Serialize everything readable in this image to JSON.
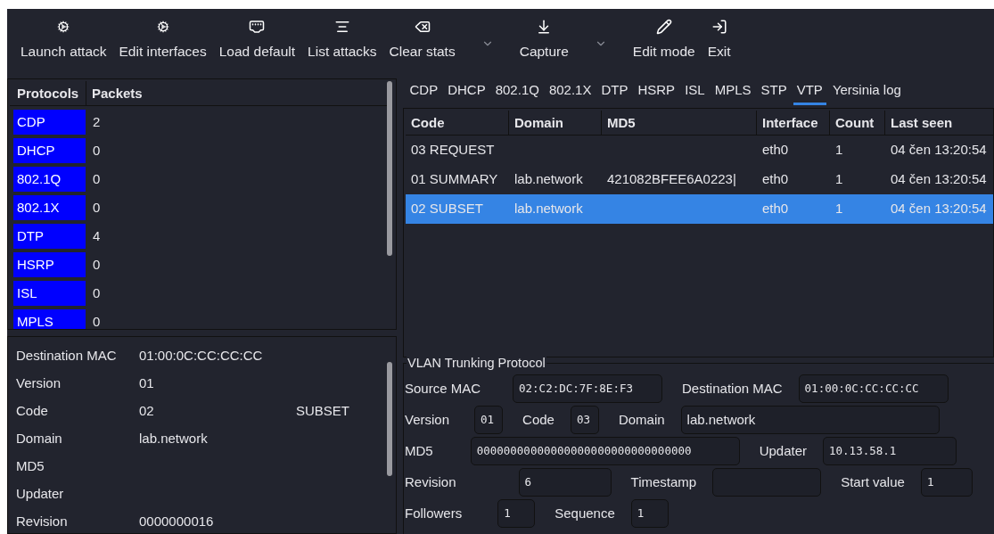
{
  "toolbar": [
    {
      "label": "Launch attack",
      "has_menu": false
    },
    {
      "label": "Edit interfaces",
      "has_menu": false
    },
    {
      "label": "Load default",
      "has_menu": false
    },
    {
      "label": "List attacks",
      "has_menu": false
    },
    {
      "label": "Clear stats",
      "has_menu": true
    },
    {
      "label": "Capture",
      "has_menu": true
    },
    {
      "label": "Edit mode",
      "has_menu": false
    },
    {
      "label": "Exit",
      "has_menu": false
    }
  ],
  "protocols_table": {
    "columns": [
      "Protocols",
      "Packets"
    ],
    "rows": [
      {
        "protocol": "CDP",
        "packets": "2"
      },
      {
        "protocol": "DHCP",
        "packets": "0"
      },
      {
        "protocol": "802.1Q",
        "packets": "0"
      },
      {
        "protocol": "802.1X",
        "packets": "0"
      },
      {
        "protocol": "DTP",
        "packets": "4"
      },
      {
        "protocol": "HSRP",
        "packets": "0"
      },
      {
        "protocol": "ISL",
        "packets": "0"
      },
      {
        "protocol": "MPLS",
        "packets": "0"
      }
    ]
  },
  "details": [
    {
      "label": "Destination MAC",
      "value": "01:00:0C:CC:CC:CC"
    },
    {
      "label": "Version",
      "value": "01"
    },
    {
      "label": "Code",
      "value": "02",
      "extra": "SUBSET"
    },
    {
      "label": "Domain",
      "value": "lab.network"
    },
    {
      "label": "MD5"
    },
    {
      "label": "Updater"
    },
    {
      "label": "Revision",
      "value": "0000000016"
    }
  ],
  "tabs": [
    {
      "label": "CDP",
      "selected": false
    },
    {
      "label": "DHCP",
      "selected": false
    },
    {
      "label": "802.1Q",
      "selected": false
    },
    {
      "label": "802.1X",
      "selected": false
    },
    {
      "label": "DTP",
      "selected": false
    },
    {
      "label": "HSRP",
      "selected": false
    },
    {
      "label": "ISL",
      "selected": false
    },
    {
      "label": "MPLS",
      "selected": false
    },
    {
      "label": "STP",
      "selected": false
    },
    {
      "label": "VTP",
      "selected": true
    },
    {
      "label": "Yersinia log",
      "selected": false
    }
  ],
  "packets_table": {
    "columns": [
      "Code",
      "Domain",
      "MD5",
      "Interface",
      "Count",
      "Last seen"
    ],
    "rows": [
      {
        "cells": [
          "03 REQUEST",
          "",
          "",
          "eth0",
          "1",
          "04 čen 13:20:54"
        ],
        "selected": false
      },
      {
        "cells": [
          "01 SUMMARY",
          "lab.network",
          "421082BFEE6A0223|",
          "eth0",
          "1",
          "04 čen 13:20:54"
        ],
        "selected": false
      },
      {
        "cells": [
          "02 SUBSET",
          "lab.network",
          "",
          "eth0",
          "1",
          "04 čen 13:20:54"
        ],
        "selected": true
      }
    ]
  },
  "vtp_form": {
    "title": "VLAN Trunking Protocol",
    "rows": [
      [
        {
          "label": "Source MAC",
          "value": "02:C2:DC:7F:8E:F3"
        },
        {
          "label": "Destination MAC",
          "value": "01:00:0C:CC:CC:CC"
        }
      ],
      [
        {
          "label": "Version",
          "value": "01"
        },
        {
          "label": "Code",
          "value": "03"
        },
        {
          "label": "Domain",
          "value": "lab.network"
        }
      ],
      [
        {
          "label": "MD5",
          "value": "00000000000000000000000000000000"
        },
        {
          "label": "Updater",
          "value": "10.13.58.1"
        }
      ],
      [
        {
          "label": "Revision",
          "value": "6"
        },
        {
          "label": "Timestamp"
        },
        {
          "label": "Start value",
          "value": "1"
        }
      ],
      [
        {
          "label": "Followers",
          "value": "1"
        },
        {
          "label": "Sequence",
          "value": "1"
        }
      ]
    ]
  }
}
